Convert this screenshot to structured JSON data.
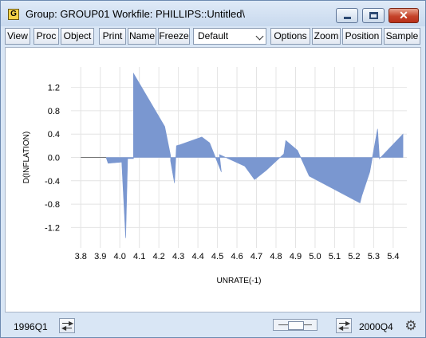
{
  "window": {
    "title": "Group: GROUP01   Workfile: PHILLIPS::Untitled\\",
    "app_icon_letter": "G",
    "close_glyph": "✕"
  },
  "toolbar": {
    "buttons": [
      "View",
      "Proc",
      "Object",
      "Print",
      "Name",
      "Freeze",
      "Options",
      "Zoom",
      "Position",
      "Sample"
    ],
    "combo_value": "Default"
  },
  "statusbar": {
    "start": "1996Q1",
    "end": "2000Q4"
  },
  "icons": {
    "app": "group-icon",
    "swap_left": "swap-arrows-icon",
    "swap_right": "swap-arrows-icon",
    "settings": "gear-icon"
  },
  "colors": {
    "fill": "#7a97d0",
    "grid": "#e4e4e4",
    "baseline": "#777777",
    "titlebar": "#c8d9ee",
    "close": "#c5432a"
  },
  "chart_data": {
    "type": "area",
    "title": "",
    "xlabel": "UNRATE(-1)",
    "ylabel": "D(INFLATION)",
    "xlim": [
      3.75,
      5.47
    ],
    "ylim": [
      -1.55,
      1.55
    ],
    "xticks": [
      "3.8",
      "3.9",
      "4.0",
      "4.1",
      "4.2",
      "4.3",
      "4.4",
      "4.5",
      "4.6",
      "4.7",
      "4.8",
      "4.9",
      "5.0",
      "5.1",
      "5.2",
      "5.3",
      "5.4"
    ],
    "yticks": [
      "1.2",
      "0.8",
      "0.4",
      "0.0",
      "-0.4",
      "-0.8",
      "-1.2"
    ],
    "grid": true,
    "series": [
      {
        "x": [
          3.8,
          3.93,
          3.94,
          4.01,
          4.03,
          4.04,
          4.07,
          4.07,
          4.23,
          4.26,
          4.26,
          4.28,
          4.29,
          4.31,
          4.42,
          4.46,
          4.52,
          4.51,
          4.64,
          4.69,
          4.75,
          4.84,
          4.85,
          4.91,
          4.97,
          5.23,
          5.24,
          5.28,
          5.32,
          5.33,
          5.33,
          5.45
        ],
        "y": [
          0.0,
          0.0,
          -0.1,
          -0.08,
          -1.38,
          -0.02,
          -0.02,
          1.44,
          0.53,
          0.03,
          -0.06,
          -0.44,
          0.2,
          0.22,
          0.35,
          0.25,
          -0.25,
          0.05,
          -0.15,
          -0.38,
          -0.22,
          0.06,
          0.29,
          0.12,
          -0.32,
          -0.78,
          -0.65,
          -0.25,
          0.49,
          -0.03,
          -0.02,
          0.4
        ]
      }
    ]
  }
}
